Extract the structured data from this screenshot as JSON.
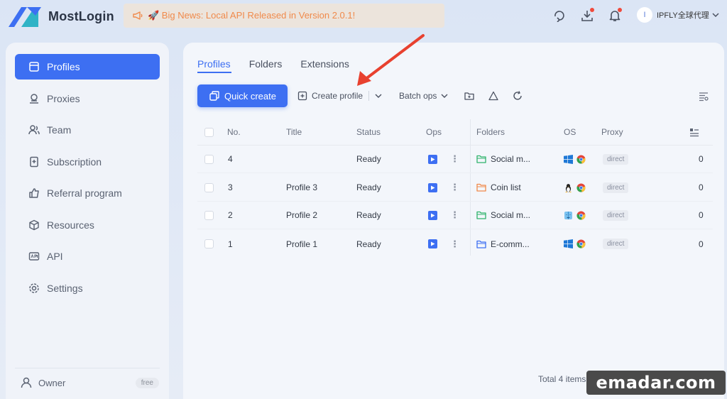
{
  "app": {
    "name": "MostLogin",
    "announcement": "🚀 Big News: Local API Released in Version 2.0.1!"
  },
  "user": {
    "avatar_letter": "I",
    "name": "IPFLY全球代理"
  },
  "sidebar": {
    "items": [
      {
        "label": "Profiles",
        "icon": "profile-icon"
      },
      {
        "label": "Proxies",
        "icon": "proxy-icon"
      },
      {
        "label": "Team",
        "icon": "team-icon"
      },
      {
        "label": "Subscription",
        "icon": "subscription-icon"
      },
      {
        "label": "Referral program",
        "icon": "thumbs-up-icon"
      },
      {
        "label": "Resources",
        "icon": "cube-icon"
      },
      {
        "label": "API",
        "icon": "api-icon"
      },
      {
        "label": "Settings",
        "icon": "gear-icon"
      }
    ],
    "owner": {
      "label": "Owner",
      "badge": "free"
    }
  },
  "main": {
    "tabs": [
      "Profiles",
      "Folders",
      "Extensions"
    ],
    "toolbar": {
      "quick_create": "Quick create",
      "create_profile": "Create profile",
      "batch_ops": "Batch ops"
    },
    "table": {
      "headers": {
        "no": "No.",
        "title": "Title",
        "status": "Status",
        "ops": "Ops",
        "folders": "Folders",
        "os": "OS",
        "proxy": "Proxy"
      },
      "rows": [
        {
          "no": "4",
          "title": "",
          "status": "Ready",
          "folder": "Social m...",
          "folder_color": "#2fb36b",
          "os": "windows",
          "proxy": "direct",
          "count": "0"
        },
        {
          "no": "3",
          "title": "Profile 3",
          "status": "Ready",
          "folder": "Coin list",
          "folder_color": "#f08a4b",
          "os": "linux",
          "proxy": "direct",
          "count": "0"
        },
        {
          "no": "2",
          "title": "Profile 2",
          "status": "Ready",
          "folder": "Social m...",
          "folder_color": "#2fb36b",
          "os": "macos",
          "proxy": "direct",
          "count": "0"
        },
        {
          "no": "1",
          "title": "Profile 1",
          "status": "Ready",
          "folder": "E-comm...",
          "folder_color": "#3d6ff2",
          "os": "windows",
          "proxy": "direct",
          "count": "0"
        }
      ]
    },
    "footer": {
      "total": "Total 4 items"
    }
  },
  "watermark": "emadar.com",
  "colors": {
    "accent": "#3d6ff2",
    "announcement_text": "#f08a4b",
    "notification_dot": "#f04a3c",
    "annotation_arrow": "#e8412f"
  }
}
